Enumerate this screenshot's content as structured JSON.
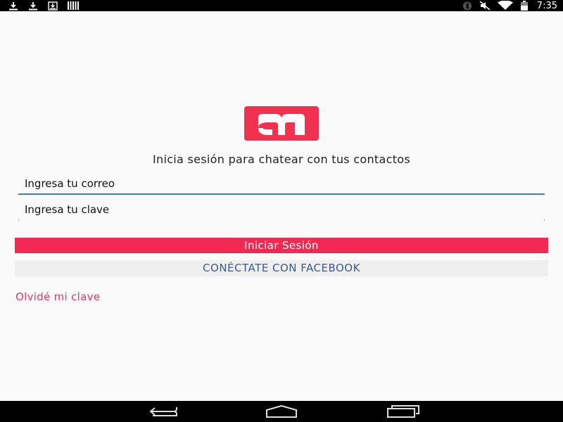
{
  "status_bar": {
    "left_icons": [
      "download-icon",
      "download-icon",
      "download-box-icon",
      "barcode-icon"
    ],
    "right_icons": [
      "bluetooth-icon",
      "mute-icon",
      "wifi-icon",
      "battery-icon"
    ],
    "time": "7:35"
  },
  "app": {
    "logo_icon": "app-logo-m-icon",
    "accent_color": "#f02a52",
    "headline": "Inicia sesión para chatear con tus contactos",
    "email_placeholder": "Ingresa tu correo",
    "password_placeholder": "Ingresa tu clave",
    "login_button": "Iniciar Sesión",
    "facebook_button": "CONÉCTATE CON FACEBOOK",
    "facebook_color": "#3b5998",
    "forgot_link": "Olvidé mi clave"
  },
  "nav_bar": {
    "buttons": [
      "back-icon",
      "home-icon",
      "recents-icon"
    ]
  }
}
